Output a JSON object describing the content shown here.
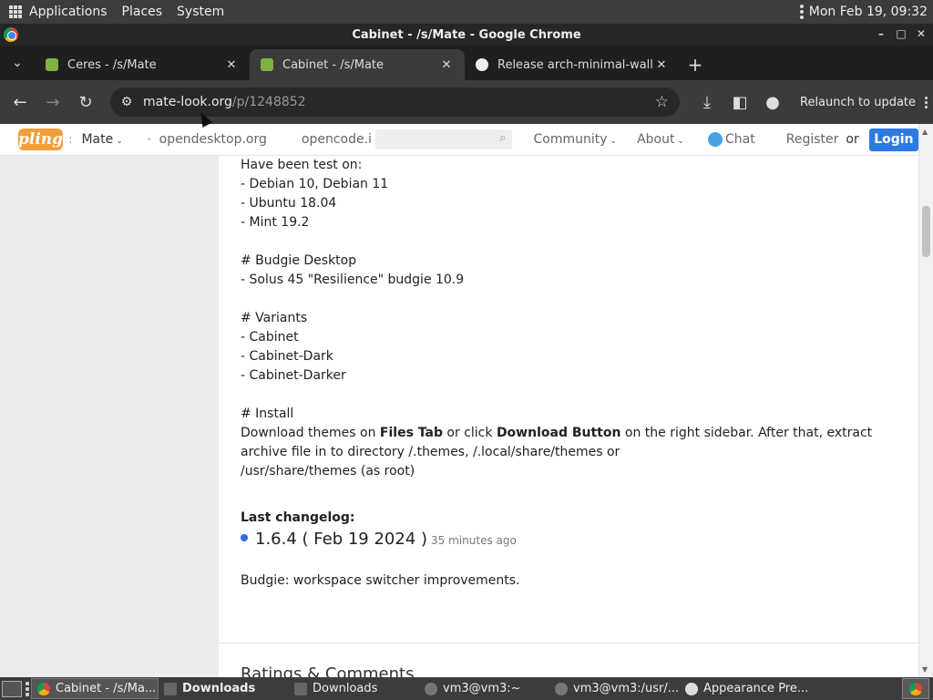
{
  "top_panel": {
    "menus": [
      "Applications",
      "Places",
      "System"
    ],
    "clock": "Mon Feb 19, 09:32"
  },
  "window": {
    "title": "Cabinet - /s/Mate - Google Chrome"
  },
  "tabs": [
    {
      "title": "Ceres - /s/Mate",
      "active": false
    },
    {
      "title": "Cabinet - /s/Mate",
      "active": true
    },
    {
      "title": "Release arch-minimal-wallp",
      "active": false
    }
  ],
  "toolbar": {
    "url_host": "mate-look.org",
    "url_path": "/p/1248852",
    "relaunch_label": "Relaunch to update"
  },
  "site_nav": {
    "logo": "pling",
    "colon": ":",
    "store": "Mate",
    "link1": "opendesktop.org",
    "link2": "opencode.i",
    "community": "Community",
    "about": "About",
    "chat": "Chat",
    "register": "Register",
    "or": "or",
    "login": "Login"
  },
  "content": {
    "lines": [
      "Have been test on:",
      "- Debian 10, Debian 11",
      "- Ubuntu 18.04",
      "- Mint 19.2",
      "",
      "# Budgie Desktop",
      "- Solus 45 \"Resilience\" budgie 10.9",
      "",
      "# Variants",
      "- Cabinet",
      "- Cabinet-Dark",
      "- Cabinet-Darker",
      "",
      "# Install"
    ],
    "install": {
      "p1": "Download themes on ",
      "b1": "Files Tab",
      "p2": " or click ",
      "b2": "Download Button",
      "p3": " on the right sidebar. After that, extract archive file in to directory /.themes, /.local/share/themes or",
      "p4": "/usr/share/themes (as root)"
    },
    "changelog_title": "Last changelog:",
    "version": "1.6.4 ( Feb 19 2024 )",
    "ago": "35 minutes ago",
    "changelog_text": "Budgie: workspace switcher improvements.",
    "ratings_heading": "Ratings & Comments"
  },
  "taskbar": [
    {
      "label": "Cabinet - /s/Ma...",
      "icon": "chrome-icon",
      "active": true,
      "bold": false
    },
    {
      "label": "Downloads",
      "icon": "folder-icon",
      "active": false,
      "bold": true
    },
    {
      "label": "Downloads",
      "icon": "folder-icon",
      "active": false,
      "bold": false
    },
    {
      "label": "vm3@vm3:~",
      "icon": "terminal-icon",
      "active": false,
      "bold": false
    },
    {
      "label": "vm3@vm3:/usr/...",
      "icon": "terminal-icon",
      "active": false,
      "bold": false
    },
    {
      "label": "Appearance Pre...",
      "icon": "preferences-icon",
      "active": false,
      "bold": false
    }
  ]
}
